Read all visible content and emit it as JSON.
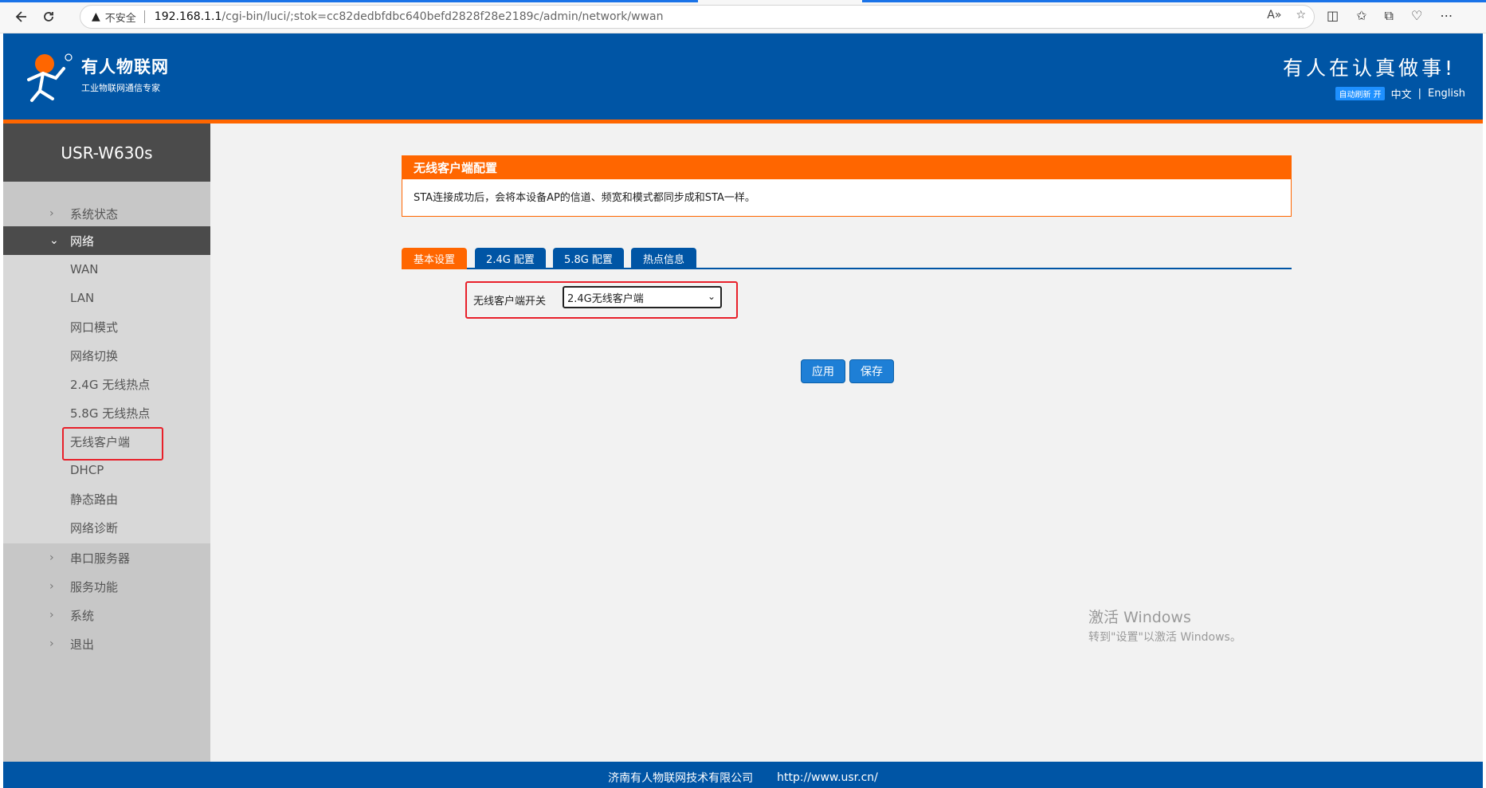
{
  "browser": {
    "insecure_label": "不安全",
    "url_host": "192.168.1.1",
    "url_path": "/cgi-bin/luci/;stok=cc82dedbfdbc640befd2828f28e2189c/admin/network/wwan"
  },
  "header": {
    "brand": "有人物联网",
    "brand_sub": "工业物联网通信专家",
    "slogan": "有人在认真做事!",
    "auto_refresh": "自动刷新 开",
    "lang_cn": "中文",
    "lang_sep": "|",
    "lang_en": "English"
  },
  "sidebar": {
    "model": "USR-W630s",
    "top_items": [
      "系统状态"
    ],
    "network": "网络",
    "network_items": [
      "WAN",
      "LAN",
      "网口模式",
      "网络切换",
      "2.4G 无线热点",
      "5.8G 无线热点",
      "无线客户端",
      "DHCP",
      "静态路由",
      "网络诊断"
    ],
    "bottom_items": [
      "串口服务器",
      "服务功能",
      "系统",
      "退出"
    ]
  },
  "main": {
    "panel_title": "无线客户端配置",
    "panel_text": "STA连接成功后，会将本设备AP的信道、频宽和模式都同步成和STA一样。",
    "tabs": [
      "基本设置",
      "2.4G 配置",
      "5.8G 配置",
      "热点信息"
    ],
    "form_label": "无线客户端开关",
    "select_value": "2.4G无线客户端",
    "apply_label": "应用",
    "save_label": "保存"
  },
  "watermark": {
    "line1": "激活 Windows",
    "line2": "转到\"设置\"以激活 Windows。"
  },
  "footer": {
    "company": "济南有人物联网技术有限公司",
    "website": "http://www.usr.cn/"
  },
  "colors": {
    "header_blue": "#0055a5",
    "accent_orange": "#ff6600",
    "highlight_red": "#e8202a"
  }
}
